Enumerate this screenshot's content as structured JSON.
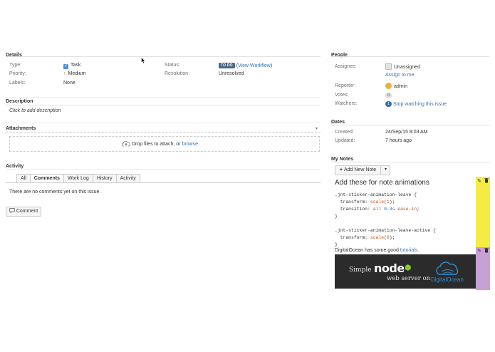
{
  "details": {
    "title": "Details",
    "type_label": "Type:",
    "type_value": "Task",
    "priority_label": "Priority:",
    "priority_value": "Medium",
    "labels_label": "Labels:",
    "labels_value": "None",
    "status_label": "Status:",
    "status_badge": "TO DO",
    "status_link": "View Workflow",
    "resolution_label": "Resolution:",
    "resolution_value": "Unresolved"
  },
  "description": {
    "title": "Description",
    "placeholder": "Click to add description"
  },
  "attachments": {
    "title": "Attachments",
    "drop_text": "Drop files to attach, or",
    "browse_link": "browse."
  },
  "activity": {
    "title": "Activity",
    "tabs": [
      "All",
      "Comments",
      "Work Log",
      "History",
      "Activity"
    ],
    "active_tab": "Comments",
    "empty_text": "There are no comments yet on this issue.",
    "comment_button": "Comment"
  },
  "people": {
    "title": "People",
    "assignee_label": "Assignee:",
    "assignee_value": "Unassigned",
    "assign_to_me": "Assign to me",
    "reporter_label": "Reporter:",
    "reporter_value": "admin",
    "votes_label": "Votes:",
    "votes_count": "0",
    "watchers_label": "Watchers:",
    "watchers_count": "1",
    "watchers_link": "Stop watching this issue"
  },
  "dates": {
    "title": "Dates",
    "created_label": "Created:",
    "created_value": "24/Sep/15 8:03 AM",
    "updated_label": "Updated:",
    "updated_value": "7 hours ago"
  },
  "notes": {
    "title": "My Notes",
    "add_button": "Add New Note",
    "note1_heading": "Add these for note animations",
    "note1_code": [
      ".jnt-sticker-animation-leave {",
      "  transform: scale(1);",
      "  transition: all 0.3s ease-in;",
      "}",
      "",
      ".jnt-sticker-animation-leave-active {",
      "  transform: scale(0);",
      "}"
    ],
    "note2_text": "DigitalOcean has some good",
    "note2_link": "tutorials.",
    "banner_simple": "Simple",
    "banner_node": "node",
    "banner_sub": "web server on",
    "banner_do": "DigitalOcean",
    "note1_color": "#f5eb45",
    "note2_color": "#c7a0d6"
  },
  "colors": {
    "link": "#3572b0",
    "status_badge": "#4a6785",
    "banner_bg": "#2b2b2b",
    "node_green": "#83cd29"
  }
}
